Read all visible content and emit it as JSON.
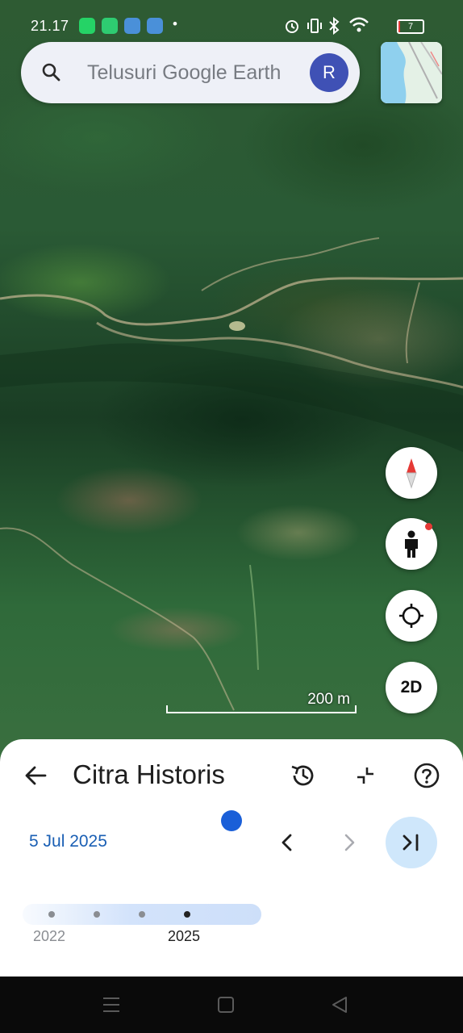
{
  "status_bar": {
    "time": "21.17",
    "battery_level": "7",
    "battery_fraction": 0.07,
    "icons": [
      "whatsapp-icon",
      "vpn-shield-icon",
      "app-icon",
      "app-icon",
      "dot-icon",
      "alarm-icon",
      "vibrate-icon",
      "bluetooth-icon",
      "wifi-icon",
      "battery-icon"
    ]
  },
  "search": {
    "placeholder": "Telusuri Google Earth",
    "avatar_letter": "R"
  },
  "map": {
    "scale_label": "200 m",
    "buttons": [
      "compass-icon",
      "street-view-icon",
      "my-location-icon",
      "2D"
    ],
    "view_mode_label": "2D"
  },
  "historical_panel": {
    "title": "Citra Historis",
    "current_date": "5 Jul 2025",
    "timeline": {
      "start_label": "2022",
      "end_label": "2025",
      "selected": "2025"
    }
  },
  "colors": {
    "accent_blue": "#1a5fd8",
    "date_blue": "#1a5fb4",
    "avatar_bg": "#3f51b5",
    "next_button_bg": "#cfe7fb"
  }
}
